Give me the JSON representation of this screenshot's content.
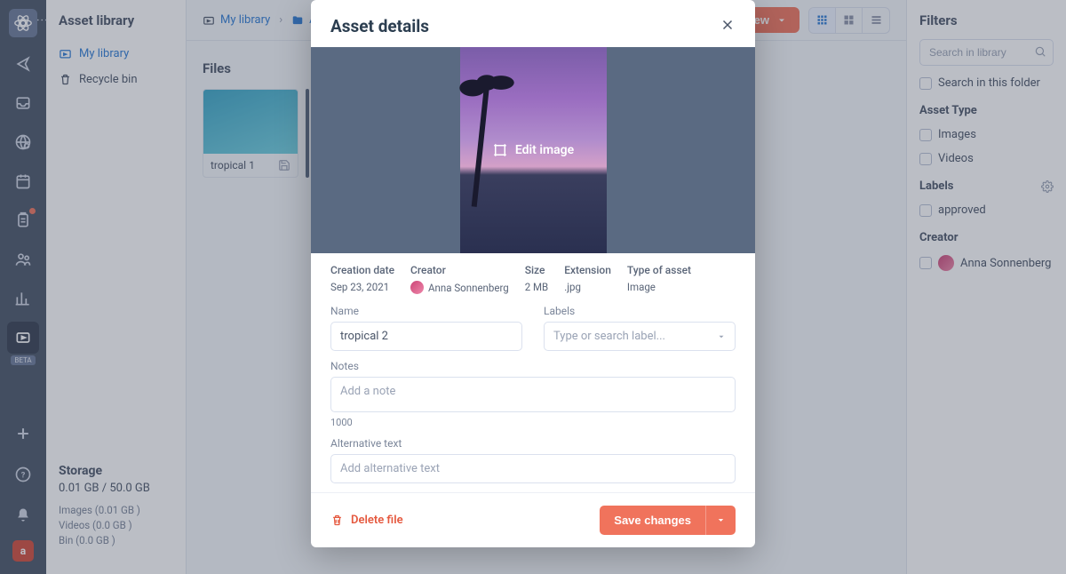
{
  "rail": {
    "beta": "BETA",
    "avatar_initial": "a"
  },
  "library": {
    "title": "Asset library",
    "nav": {
      "my_library": "My library",
      "recycle": "Recycle bin"
    },
    "storage": {
      "title": "Storage",
      "value": "0.01 GB / 50.0 GB",
      "images": "Images (0.01 GB )",
      "videos": "Videos (0.0 GB )",
      "bin": "Bin (0.0 GB )"
    }
  },
  "topbar": {
    "crumb_root": "My library",
    "crumb_next": "A",
    "create": "Create New"
  },
  "files": {
    "heading": "Files",
    "thumb1": "tropical 1"
  },
  "filters": {
    "title": "Filters",
    "search_ph": "Search in library",
    "search_folder": "Search in this folder",
    "asset_type": "Asset Type",
    "images": "Images",
    "videos": "Videos",
    "labels": "Labels",
    "approved": "approved",
    "creator": "Creator",
    "creator_name": "Anna Sonnenberg"
  },
  "modal": {
    "title": "Asset details",
    "edit_image": "Edit image",
    "meta": {
      "creation_date_l": "Creation date",
      "creation_date": "Sep 23, 2021",
      "creator_l": "Creator",
      "creator": "Anna Sonnenberg",
      "size_l": "Size",
      "size": "2 MB",
      "ext_l": "Extension",
      "ext": ".jpg",
      "type_l": "Type of asset",
      "type": "Image"
    },
    "name_l": "Name",
    "name_v": "tropical 2",
    "labels_l": "Labels",
    "labels_ph": "Type or search label...",
    "notes_l": "Notes",
    "notes_ph": "Add a note",
    "counter": "1000",
    "alt_l": "Alternative text",
    "alt_ph": "Add alternative text",
    "delete": "Delete file",
    "save": "Save changes"
  }
}
